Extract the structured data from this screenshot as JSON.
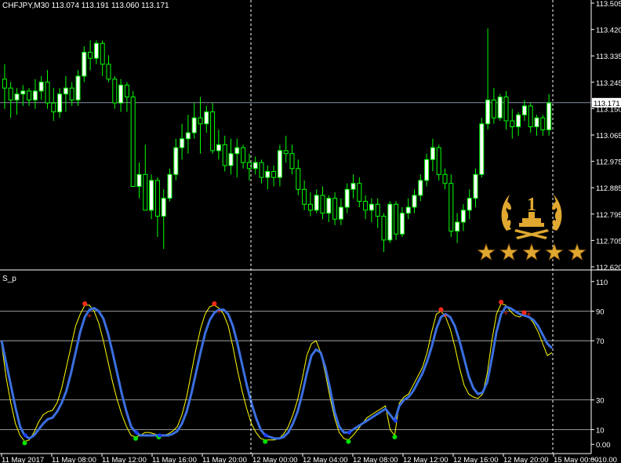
{
  "header": {
    "symbol_tf": "CHFJPY,M30",
    "ohlc": "113.074 113.191 113.060 113.171"
  },
  "indicator": {
    "name": "S_p"
  },
  "current_price_label": "113.171",
  "colors": {
    "background": "#000000",
    "candle": "#00ff00",
    "bull_body": "#ffffff",
    "grid": "#c0c0c0",
    "slow_line": "#3b6fe0",
    "fast_line": "#ffff00",
    "signal_top": "#ff2a1a",
    "signal_bottom": "#00e000",
    "gold": "#e0a830"
  },
  "badge": {
    "rank": "1",
    "stars": 5,
    "icon": "trophy-laurel-icon"
  },
  "chart_data": [
    {
      "type": "candlestick",
      "title": "CHFJPY,M30",
      "ylim": [
        112.62,
        113.505
      ],
      "price_ticks": [
        "113.505",
        "113.420",
        "113.335",
        "113.245",
        "113.150",
        "113.065",
        "112.975",
        "112.885",
        "112.795",
        "112.705",
        "112.620"
      ],
      "time_labels": [
        "11 May 2017",
        "11 May 08:00",
        "11 May 12:00",
        "11 May 16:00",
        "11 May 20:00",
        "12 May 00:00",
        "12 May 04:00",
        "12 May 08:00",
        "12 May 12:00",
        "12 May 16:00",
        "12 May 20:00",
        "15 May 00:00"
      ],
      "current_price": 113.171,
      "candles": [
        [
          113.25,
          113.3,
          113.15,
          113.22
        ],
        [
          113.22,
          113.24,
          113.12,
          113.18
        ],
        [
          113.18,
          113.22,
          113.13,
          113.2
        ],
        [
          113.2,
          113.23,
          113.16,
          113.21
        ],
        [
          113.21,
          113.22,
          113.16,
          113.18
        ],
        [
          113.18,
          113.25,
          113.15,
          113.21
        ],
        [
          113.21,
          113.26,
          113.18,
          113.24
        ],
        [
          113.24,
          113.28,
          113.15,
          113.17
        ],
        [
          113.17,
          113.22,
          113.11,
          113.14
        ],
        [
          113.14,
          113.22,
          113.12,
          113.2
        ],
        [
          113.2,
          113.26,
          113.14,
          113.22
        ],
        [
          113.22,
          113.24,
          113.16,
          113.18
        ],
        [
          113.18,
          113.28,
          113.16,
          113.26
        ],
        [
          113.26,
          113.36,
          113.24,
          113.34
        ],
        [
          113.34,
          113.38,
          113.28,
          113.32
        ],
        [
          113.32,
          113.38,
          113.3,
          113.37
        ],
        [
          113.37,
          113.38,
          113.26,
          113.3
        ],
        [
          113.3,
          113.33,
          113.24,
          113.25
        ],
        [
          113.25,
          113.26,
          113.15,
          113.17
        ],
        [
          113.17,
          113.25,
          113.14,
          113.23
        ],
        [
          113.23,
          113.24,
          113.14,
          113.19
        ],
        [
          113.19,
          113.21,
          112.95,
          112.89
        ],
        [
          112.89,
          112.97,
          112.85,
          112.93
        ],
        [
          112.93,
          113.03,
          112.82,
          112.81
        ],
        [
          112.81,
          112.93,
          112.78,
          112.91
        ],
        [
          112.91,
          112.92,
          112.72,
          112.79
        ],
        [
          112.79,
          112.88,
          112.68,
          112.85
        ],
        [
          112.85,
          112.95,
          112.84,
          112.93
        ],
        [
          112.93,
          113.05,
          112.91,
          113.02
        ],
        [
          113.02,
          113.1,
          112.98,
          113.05
        ],
        [
          113.05,
          113.13,
          113.0,
          113.07
        ],
        [
          113.07,
          113.17,
          113.05,
          113.12
        ],
        [
          113.12,
          113.19,
          113.0,
          113.1
        ],
        [
          113.1,
          113.16,
          113.07,
          113.14
        ],
        [
          113.14,
          113.17,
          113.0,
          113.01
        ],
        [
          113.01,
          113.08,
          112.98,
          113.03
        ],
        [
          113.03,
          113.06,
          112.94,
          112.96
        ],
        [
          112.96,
          113.05,
          112.93,
          113.0
        ],
        [
          113.0,
          113.05,
          112.92,
          113.02
        ],
        [
          113.02,
          113.03,
          112.95,
          112.97
        ],
        [
          112.97,
          113.0,
          112.91,
          112.95
        ],
        [
          112.95,
          112.99,
          112.93,
          112.97
        ],
        [
          112.97,
          112.98,
          112.9,
          112.92
        ],
        [
          112.92,
          112.96,
          112.88,
          112.94
        ],
        [
          112.94,
          112.96,
          112.89,
          112.92
        ],
        [
          112.92,
          113.03,
          112.89,
          113.01
        ],
        [
          113.01,
          113.06,
          112.97,
          113.0
        ],
        [
          113.0,
          113.03,
          112.93,
          112.95
        ],
        [
          112.95,
          112.98,
          112.86,
          112.88
        ],
        [
          112.88,
          112.91,
          112.81,
          112.83
        ],
        [
          112.83,
          112.87,
          112.79,
          112.81
        ],
        [
          112.81,
          112.88,
          112.8,
          112.86
        ],
        [
          112.86,
          112.89,
          112.78,
          112.8
        ],
        [
          112.8,
          112.86,
          112.77,
          112.85
        ],
        [
          112.85,
          112.87,
          112.76,
          112.78
        ],
        [
          112.78,
          112.85,
          112.76,
          112.82
        ],
        [
          112.82,
          112.9,
          112.8,
          112.88
        ],
        [
          112.88,
          112.93,
          112.85,
          112.9
        ],
        [
          112.9,
          112.92,
          112.82,
          112.84
        ],
        [
          112.84,
          112.86,
          112.78,
          112.81
        ],
        [
          112.81,
          112.85,
          112.77,
          112.83
        ],
        [
          112.83,
          112.85,
          112.75,
          112.79
        ],
        [
          112.79,
          112.8,
          112.67,
          112.71
        ],
        [
          112.71,
          112.84,
          112.7,
          112.83
        ],
        [
          112.83,
          112.84,
          112.71,
          112.73
        ],
        [
          112.73,
          112.82,
          112.72,
          112.8
        ],
        [
          112.8,
          112.85,
          112.78,
          112.82
        ],
        [
          112.82,
          112.88,
          112.8,
          112.86
        ],
        [
          112.86,
          112.93,
          112.84,
          112.91
        ],
        [
          112.91,
          113.0,
          112.89,
          112.98
        ],
        [
          112.98,
          113.05,
          112.94,
          113.02
        ],
        [
          113.02,
          113.03,
          112.91,
          112.93
        ],
        [
          112.93,
          112.95,
          112.88,
          112.9
        ],
        [
          112.9,
          112.93,
          112.72,
          112.74
        ],
        [
          112.74,
          112.8,
          112.7,
          112.77
        ],
        [
          112.77,
          112.83,
          112.74,
          112.81
        ],
        [
          112.81,
          112.88,
          112.78,
          112.85
        ],
        [
          112.85,
          112.95,
          112.82,
          112.93
        ],
        [
          112.93,
          113.12,
          112.92,
          113.1
        ],
        [
          113.1,
          113.42,
          113.08,
          113.18
        ],
        [
          113.18,
          113.22,
          113.1,
          113.12
        ],
        [
          113.12,
          113.2,
          113.11,
          113.19
        ],
        [
          113.19,
          113.21,
          113.08,
          113.11
        ],
        [
          113.11,
          113.15,
          113.05,
          113.09
        ],
        [
          113.09,
          113.14,
          113.06,
          113.13
        ],
        [
          113.13,
          113.18,
          113.11,
          113.16
        ],
        [
          113.16,
          113.17,
          113.07,
          113.09
        ],
        [
          113.09,
          113.13,
          113.06,
          113.12
        ],
        [
          113.12,
          113.13,
          113.06,
          113.08
        ],
        [
          113.08,
          113.2,
          113.06,
          113.17
        ]
      ]
    },
    {
      "type": "line",
      "title": "S_p",
      "ylim": [
        -2,
        112
      ],
      "yticks": [
        "110",
        "90",
        "70",
        "30",
        "10",
        "0.00",
        "-10.00"
      ],
      "levels": [
        90,
        70,
        30,
        10
      ],
      "series": [
        {
          "key": "slow",
          "values": [
            70,
            55,
            40,
            25,
            12,
            6,
            4,
            6,
            10,
            14,
            17,
            18,
            22,
            28,
            36,
            48,
            62,
            76,
            86,
            91,
            92,
            90,
            85,
            75,
            62,
            48,
            34,
            22,
            12,
            8,
            6,
            6,
            6,
            6,
            6,
            6,
            6,
            7,
            9,
            14,
            22,
            34,
            48,
            62,
            75,
            84,
            89,
            91,
            91,
            88,
            80,
            68,
            54,
            40,
            28,
            18,
            10,
            6,
            5,
            4,
            4,
            5,
            8,
            14,
            22,
            34,
            48,
            60,
            64,
            62,
            52,
            38,
            22,
            12,
            8,
            8,
            10,
            12,
            14,
            16,
            18,
            20,
            22,
            24,
            20,
            16,
            26,
            30,
            32,
            36,
            42,
            48,
            56,
            66,
            78,
            86,
            88,
            86,
            80,
            70,
            58,
            46,
            38,
            34,
            35,
            42,
            58,
            76,
            88,
            93,
            92,
            90,
            88,
            87,
            86,
            84,
            80,
            74,
            68,
            65
          ]
        },
        {
          "key": "fast",
          "values": [
            68,
            45,
            28,
            14,
            6,
            2,
            3,
            8,
            15,
            20,
            22,
            23,
            28,
            38,
            52,
            66,
            80,
            88,
            94,
            94,
            90,
            82,
            70,
            56,
            42,
            30,
            20,
            12,
            6,
            5,
            6,
            8,
            8,
            7,
            6,
            6,
            7,
            9,
            12,
            20,
            32,
            48,
            64,
            78,
            88,
            93,
            94,
            92,
            88,
            80,
            66,
            50,
            36,
            24,
            14,
            8,
            4,
            3,
            3,
            3,
            4,
            7,
            12,
            20,
            30,
            44,
            60,
            68,
            70,
            62,
            48,
            32,
            18,
            8,
            4,
            3,
            6,
            10,
            14,
            18,
            20,
            22,
            24,
            26,
            10,
            6,
            28,
            32,
            34,
            40,
            46,
            52,
            62,
            76,
            88,
            90,
            86,
            78,
            66,
            52,
            40,
            34,
            32,
            31,
            34,
            48,
            70,
            88,
            95,
            94,
            90,
            87,
            86,
            88,
            86,
            82,
            76,
            68,
            60,
            62
          ]
        }
      ]
    }
  ]
}
